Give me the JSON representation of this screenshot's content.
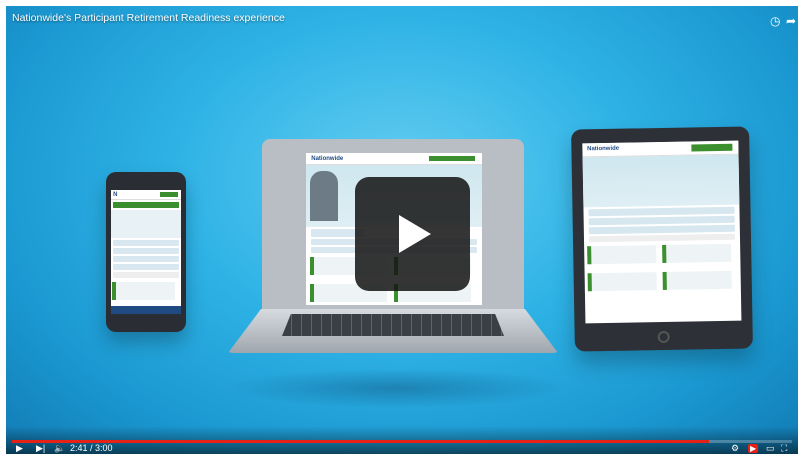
{
  "video": {
    "title": "Nationwide's Participant Retirement Readiness experience",
    "time": "2:41 / 3:00",
    "progress": 0.894
  },
  "icons": {
    "clock": "clock-icon",
    "share": "share-icon",
    "play": "play-icon",
    "next": "next-icon",
    "volume": "volume-icon",
    "settings": "settings-icon",
    "youtube": "youtube-logo",
    "tv": "tv-icon",
    "fullscreen": "fullscreen-icon"
  },
  "colors": {
    "background": "#2fb3e6",
    "progress": "#e62117",
    "brand_green": "#3c8f2e"
  }
}
